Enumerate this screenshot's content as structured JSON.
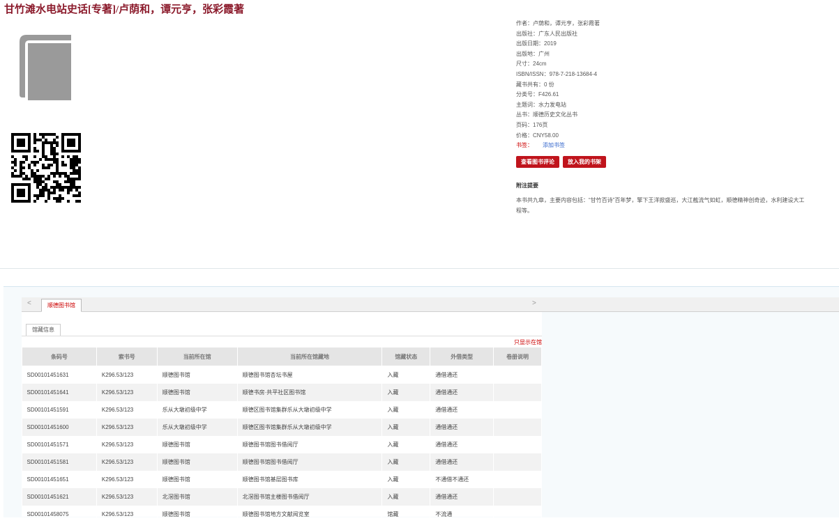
{
  "page": {
    "title": "甘竹滩水电站史话[专著]/卢荫和，谭元亨，张彩霞著"
  },
  "meta": {
    "author": "作者：卢荫和，谭元亨，张彩霞著",
    "publisher": "出版社：广东人民出版社",
    "date": "出版日期：2019",
    "place": "出版地：广州",
    "size": "尺寸：24cm",
    "isbn": "ISBN/ISSN：978-7-218-13684-4",
    "copies": "藏书共有：0 份",
    "classno": "分类号：F426.61",
    "subject": "主题词：水力发电站",
    "series": "丛书：顺德历史文化丛书",
    "pages": "页码：176页",
    "price": "价格：CNY58.00",
    "tag_label": "书签：",
    "tag_link": "添加书签"
  },
  "buttons": {
    "review": "查看图书评论",
    "shelf": "放入我的书架"
  },
  "summary": {
    "heading": "附注提要",
    "text": "本书共九章，主要内容包括：“甘竹百诗”百年梦，擎下王洋掀盛巡，大江截流气如虹，顺德精神创奇迹，水利建设大工程等。"
  },
  "holdings": {
    "tab": "顺德图书馆",
    "subtab": "馆藏信息",
    "only_label": "只显示在馆",
    "columns": [
      "条码号",
      "索书号",
      "当前所在馆",
      "当前所在馆藏地",
      "馆藏状态",
      "外借类型",
      "卷册说明"
    ],
    "rows": [
      [
        "SD00101451631",
        "K296.53/123",
        "顺德图书馆",
        "顺德图书馆杏坛书屋",
        "入藏",
        "通借通还",
        ""
      ],
      [
        "SD00101451641",
        "K296.53/123",
        "顺德图书馆",
        "顺德书房·共平社区图书馆",
        "入藏",
        "通借通还",
        ""
      ],
      [
        "SD00101451591",
        "K296.53/123",
        "乐从大墩初级中学",
        "顺德区图书馆集群乐从大墩初级中学",
        "入藏",
        "通借通还",
        ""
      ],
      [
        "SD00101451600",
        "K296.53/123",
        "乐从大墩初级中学",
        "顺德区图书馆集群乐从大墩初级中学",
        "入藏",
        "通借通还",
        ""
      ],
      [
        "SD00101451571",
        "K296.53/123",
        "顺德图书馆",
        "顺德图书馆图书借阅厅",
        "入藏",
        "通借通还",
        ""
      ],
      [
        "SD00101451581",
        "K296.53/123",
        "顺德图书馆",
        "顺德图书馆图书借阅厅",
        "入藏",
        "通借通还",
        ""
      ],
      [
        "SD00101451651",
        "K296.53/123",
        "顺德图书馆",
        "顺德图书馆基层图书库",
        "入藏",
        "不通借不通还",
        ""
      ],
      [
        "SD00101451621",
        "K296.53/123",
        "北滘图书馆",
        "北滘图书馆主楼图书借阅厅",
        "入藏",
        "通借通还",
        ""
      ],
      [
        "SD00101458075",
        "K296.53/123",
        "顺德图书馆",
        "顺德图书馆地方文献阅览室",
        "馆藏",
        "不流通",
        ""
      ]
    ]
  },
  "colors": {
    "accent": "#c0141c",
    "title": "#8b1a2b"
  },
  "icons": {
    "cover": "book-icon",
    "qr": "qr-code-icon"
  }
}
